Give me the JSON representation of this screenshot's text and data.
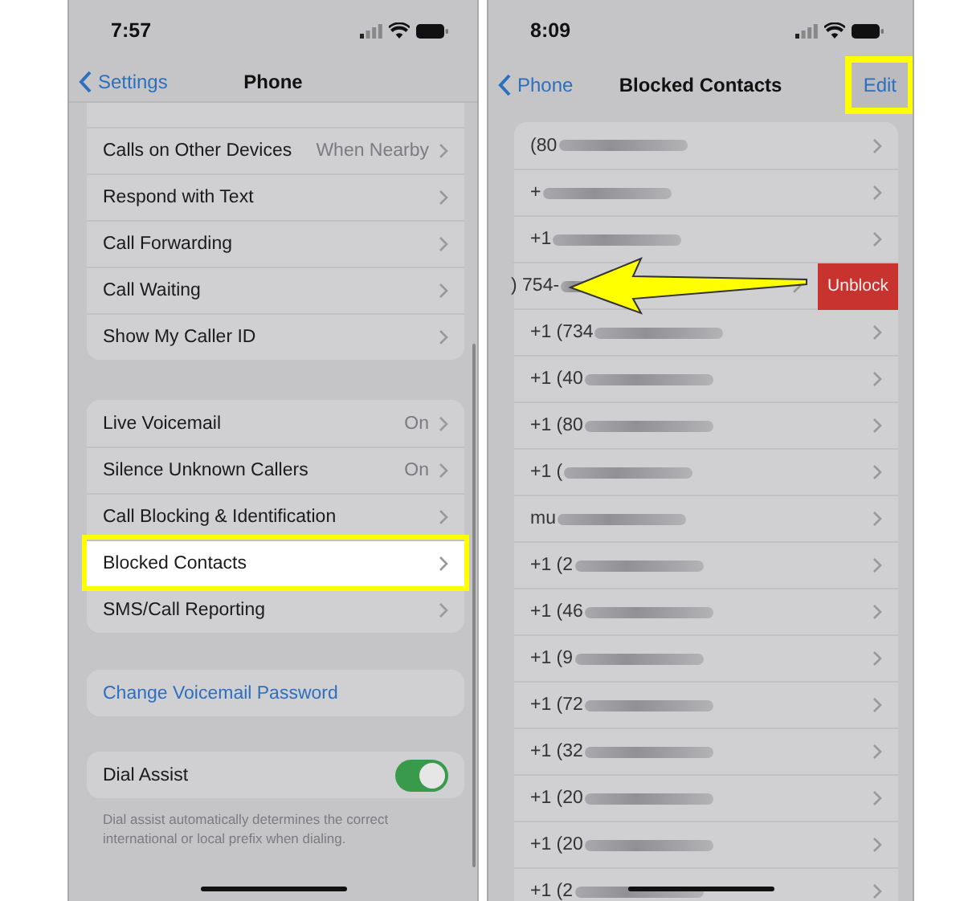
{
  "settings_screen": {
    "status_time": "7:57",
    "nav": {
      "back": "Settings",
      "title": "Phone"
    },
    "groups": [
      {
        "kind": "list",
        "rows": [
          {
            "label": "Calls on Other Devices",
            "value": "When Nearby",
            "highlighted": false
          },
          {
            "label": "Respond with Text",
            "highlighted": false
          },
          {
            "label": "Call Forwarding",
            "highlighted": false
          },
          {
            "label": "Call Waiting",
            "highlighted": false
          },
          {
            "label": "Show My Caller ID",
            "highlighted": false
          }
        ]
      },
      {
        "kind": "list",
        "rows": [
          {
            "label": "Live Voicemail",
            "value": "On",
            "highlighted": false
          },
          {
            "label": "Silence Unknown Callers",
            "value": "On",
            "highlighted": false
          },
          {
            "label": "Call Blocking & Identification",
            "highlighted": false
          },
          {
            "label": "Blocked Contacts",
            "highlighted": true
          },
          {
            "label": "SMS/Call Reporting",
            "highlighted": false
          }
        ]
      },
      {
        "kind": "link",
        "label": "Change Voicemail Password"
      },
      {
        "kind": "toggle",
        "label": "Dial Assist",
        "on": true,
        "footnote": "Dial assist automatically determines the correct international or local prefix when dialing."
      }
    ]
  },
  "blocked_screen": {
    "status_time": "8:09",
    "nav": {
      "back": "Phone",
      "title": "Blocked Contacts",
      "action": "Edit",
      "action_highlighted": true
    },
    "contacts": [
      {
        "number": "(80",
        "swiped": false
      },
      {
        "number": "+",
        "swiped": false
      },
      {
        "number": "+1",
        "swiped": false
      },
      {
        "number": ") 754-",
        "swiped": true,
        "action": "Unblock"
      },
      {
        "number": "+1 (734",
        "swiped": false
      },
      {
        "number": "+1 (40",
        "swiped": false
      },
      {
        "number": "+1 (80",
        "swiped": false
      },
      {
        "number": "+1 (",
        "swiped": false
      },
      {
        "number": "mu",
        "swiped": false
      },
      {
        "number": "+1 (2",
        "swiped": false
      },
      {
        "number": "+1 (46",
        "swiped": false
      },
      {
        "number": "+1 (9",
        "swiped": false
      },
      {
        "number": "+1 (72",
        "swiped": false
      },
      {
        "number": "+1 (32",
        "swiped": false
      },
      {
        "number": "+1 (20",
        "swiped": false
      },
      {
        "number": "+1 (20",
        "swiped": false
      },
      {
        "number": "+1 (2",
        "swiped": false
      }
    ]
  }
}
